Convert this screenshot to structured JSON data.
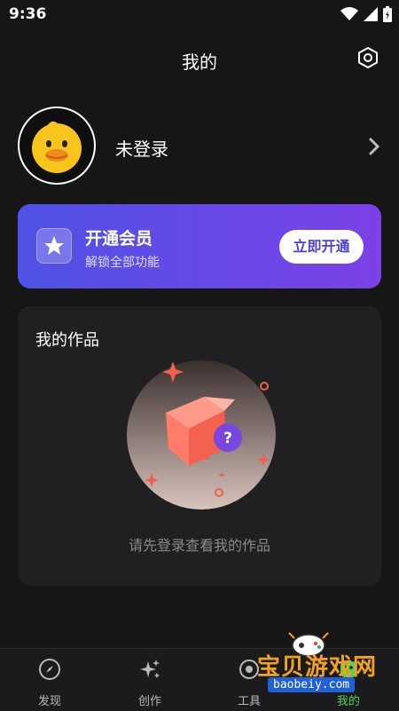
{
  "status_bar": {
    "time": "9:36"
  },
  "header": {
    "title": "我的"
  },
  "profile": {
    "name": "未登录"
  },
  "vip": {
    "title": "开通会员",
    "subtitle": "解锁全部功能",
    "button": "立即开通"
  },
  "works": {
    "title": "我的作品",
    "empty_hint": "请先登录查看我的作品"
  },
  "bottom_nav": {
    "items": [
      {
        "label": "发现",
        "icon": "compass-icon"
      },
      {
        "label": "创作",
        "icon": "sparkle-icon"
      },
      {
        "label": "工具",
        "icon": "toolbox-icon"
      },
      {
        "label": "我的",
        "icon": "profile-icon",
        "active": true
      }
    ]
  },
  "watermark": {
    "title": "宝贝游戏网",
    "url": "baobeiy.com"
  },
  "colors": {
    "background": "#161617",
    "vip_gradient_start": "#4f52e6",
    "vip_gradient_end": "#7b42e6",
    "active_nav": "#4ad65c",
    "card": "#202023"
  }
}
